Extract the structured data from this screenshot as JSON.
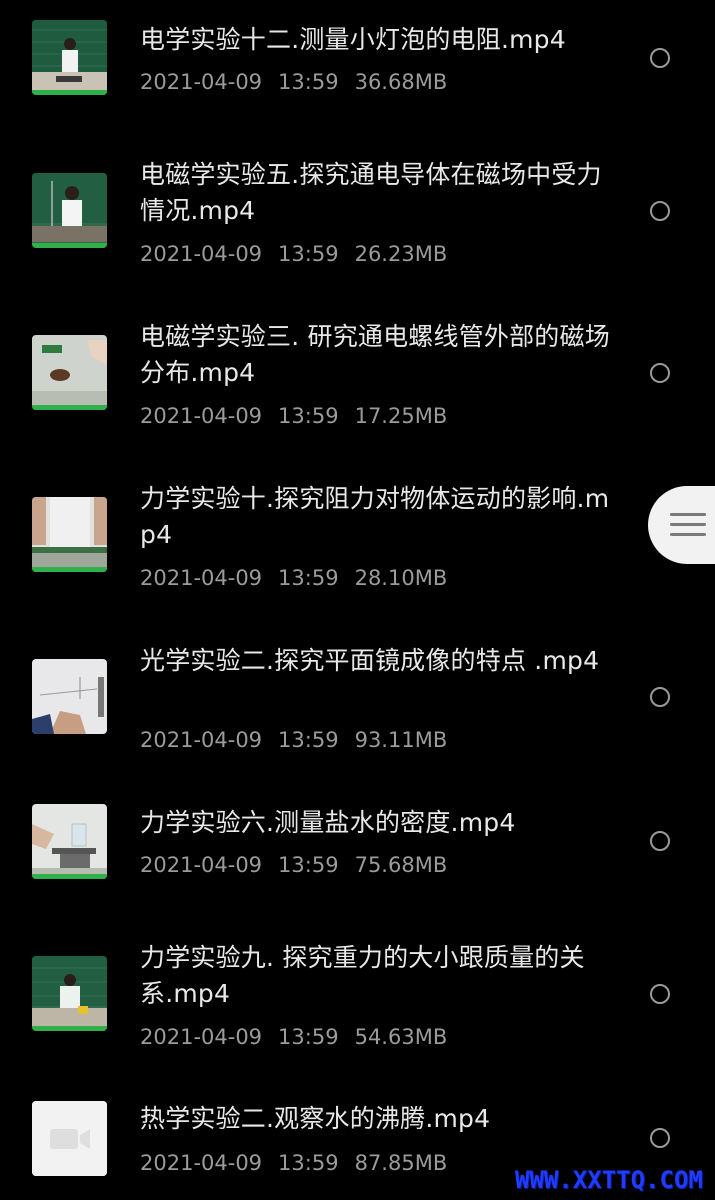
{
  "files": [
    {
      "title": "电学实验十二.测量小灯泡的电阻.mp4",
      "date": "2021-04-09",
      "time": "13:59",
      "size": "36.68MB",
      "thumb_icon": "video-thumbnail-teacher-blackboard-icon"
    },
    {
      "title": "电磁学实验五.探究通电导体在磁场中受力情况.mp4",
      "date": "2021-04-09",
      "time": "13:59",
      "size": "26.23MB",
      "thumb_icon": "video-thumbnail-teacher-blackboard-icon"
    },
    {
      "title": "电磁学实验三. 研究通电螺线管外部的磁场分布.mp4",
      "date": "2021-04-09",
      "time": "13:59",
      "size": "17.25MB",
      "thumb_icon": "video-thumbnail-apparatus-icon"
    },
    {
      "title": "力学实验十.探究阻力对物体运动的影响.mp4",
      "date": "2021-04-09",
      "time": "13:59",
      "size": "28.10MB",
      "thumb_icon": "video-thumbnail-apparatus-icon"
    },
    {
      "title": "光学实验二.探究平面镜成像的特点 .mp4",
      "date": "2021-04-09",
      "time": "13:59",
      "size": "93.11MB",
      "thumb_icon": "video-thumbnail-apparatus-icon"
    },
    {
      "title": "力学实验六.测量盐水的密度.mp4",
      "date": "2021-04-09",
      "time": "13:59",
      "size": "75.68MB",
      "thumb_icon": "video-thumbnail-apparatus-icon"
    },
    {
      "title": "力学实验九. 探究重力的大小跟质量的关系.mp4",
      "date": "2021-04-09",
      "time": "13:59",
      "size": "54.63MB",
      "thumb_icon": "video-thumbnail-teacher-blackboard-icon"
    },
    {
      "title": "热学实验二.观察水的沸腾.mp4",
      "date": "2021-04-09",
      "time": "13:59",
      "size": "87.85MB",
      "thumb_icon": "video-camera-icon"
    }
  ],
  "floating_menu": {
    "icon": "hamburger-menu-icon"
  },
  "watermark": {
    "text": "WWW.XXTTQ.COM",
    "color": "#1f3cff"
  },
  "colors": {
    "background": "#000000",
    "title": "#e8e8e8",
    "meta": "#9b9b9b",
    "radio": "#9a9a9a"
  }
}
